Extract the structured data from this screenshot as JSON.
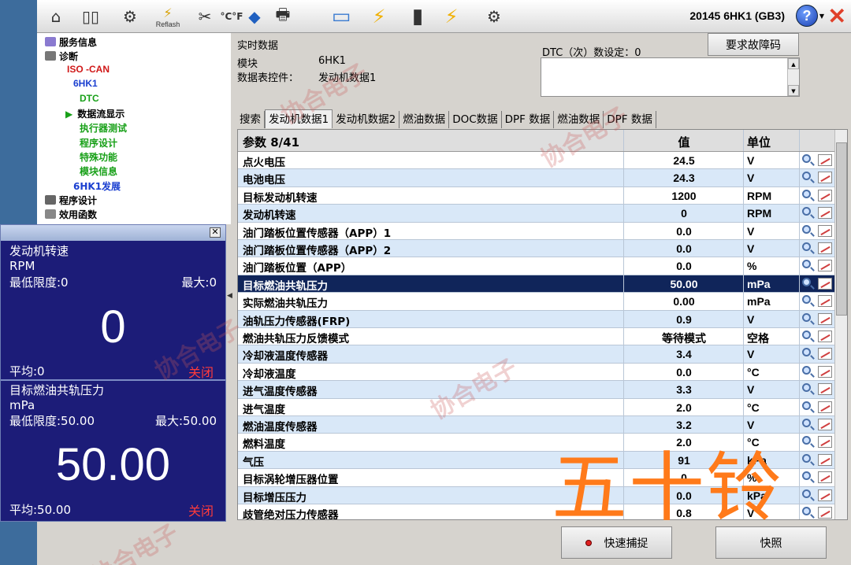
{
  "toolbar": {
    "reflash_label": "Reflash",
    "vehicle": "20145 6HK1 (GB3)",
    "help_label": "?"
  },
  "nav": {
    "service_info": "服务信息",
    "diagnosis": "诊断",
    "iso_can": "ISO -CAN",
    "engine": "6HK1",
    "dtc": "DTC",
    "data_display": "数据流显示",
    "actuator_test": "执行器测试",
    "programming_sub": "程序设计",
    "special_functions": "特殊功能",
    "module_info": "模块信息",
    "engine_dev": "6HK1发展",
    "programming": "程序设计",
    "utilities": "效用函数"
  },
  "gauges": {
    "close_x": "✕",
    "items": [
      {
        "name": "发动机转速",
        "unit": "RPM",
        "min_label": "最低限度:0",
        "max_label": "最大:0",
        "value": "0",
        "avg_label": "平均:0",
        "close_label": "关闭"
      },
      {
        "name": "目标燃油共轨压力",
        "unit": "mPa",
        "min_label": "最低限度:50.00",
        "max_label": "最大:50.00",
        "value": "50.00",
        "avg_label": "平均:50.00",
        "close_label": "关闭"
      }
    ]
  },
  "header": {
    "title": "实时数据",
    "module_label": "模块",
    "module_value": "6HK1",
    "ds_label": "数据表控件：",
    "ds_value": "发动机数据1",
    "dtc_label": "DTC（次）数设定：0",
    "request_button": "要求故障码"
  },
  "tabs": [
    "搜索",
    "发动机数据1",
    "发动机数据2",
    "燃油数据",
    "DOC数据",
    "DPF 数据",
    "燃油数据",
    "DPF 数据"
  ],
  "table": {
    "col_param": "参数 8/41",
    "col_value": "值",
    "col_unit": "单位",
    "rows": [
      {
        "name": "点火电压",
        "value": "24.5",
        "unit": "V"
      },
      {
        "name": "电池电压",
        "value": "24.3",
        "unit": "V"
      },
      {
        "name": "目标发动机转速",
        "value": "1200",
        "unit": "RPM"
      },
      {
        "name": "发动机转速",
        "value": "0",
        "unit": "RPM"
      },
      {
        "name": "油门踏板位置传感器（APP）1",
        "value": "0.0",
        "unit": "V"
      },
      {
        "name": "油门踏板位置传感器（APP）2",
        "value": "0.0",
        "unit": "V"
      },
      {
        "name": "油门踏板位置（APP）",
        "value": "0.0",
        "unit": "%"
      },
      {
        "name": "目标燃油共轨压力",
        "value": "50.00",
        "unit": "mPa",
        "selected": true
      },
      {
        "name": "实际燃油共轨压力",
        "value": "0.00",
        "unit": "mPa"
      },
      {
        "name": "油轨压力传感器(FRP)",
        "value": "0.9",
        "unit": "V"
      },
      {
        "name": "燃油共轨压力反馈模式",
        "value": "等待模式",
        "unit": "空格"
      },
      {
        "name": "冷却液温度传感器",
        "value": "3.4",
        "unit": "V"
      },
      {
        "name": "冷却液温度",
        "value": "0.0",
        "unit": "°C"
      },
      {
        "name": "进气温度传感器",
        "value": "3.3",
        "unit": "V"
      },
      {
        "name": "进气温度",
        "value": "2.0",
        "unit": "°C"
      },
      {
        "name": "燃油温度传感器",
        "value": "3.2",
        "unit": "V"
      },
      {
        "name": "燃料温度",
        "value": "2.0",
        "unit": "°C"
      },
      {
        "name": "气压",
        "value": "91",
        "unit": "kPa"
      },
      {
        "name": "目标涡轮增压器位置",
        "value": "0",
        "unit": "%"
      },
      {
        "name": "目标增压压力",
        "value": "0.0",
        "unit": "kPa"
      },
      {
        "name": "歧管绝对压力传感器",
        "value": "0.8",
        "unit": "V"
      }
    ]
  },
  "buttons": {
    "quick_capture": "快速捕捉",
    "snapshot": "快照"
  },
  "watermark": "协合电子",
  "overlay_brand": "五十铃"
}
